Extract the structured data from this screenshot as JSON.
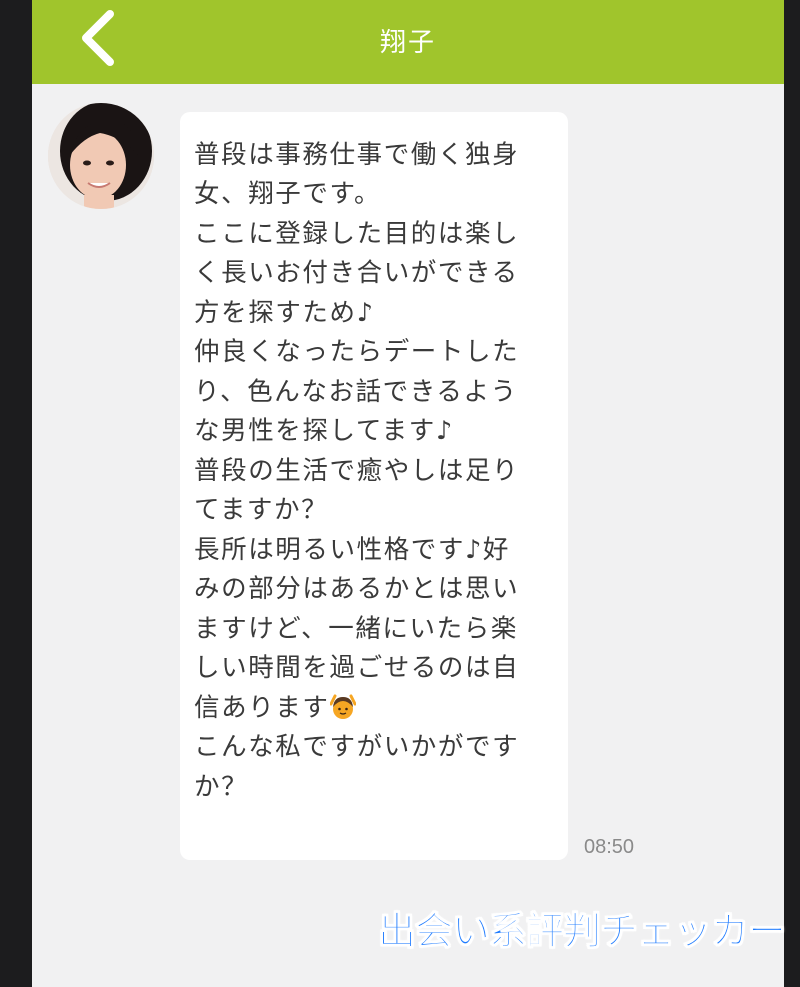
{
  "header": {
    "title": "翔子",
    "back_icon": "chevron-left-icon",
    "background_color": "#a0c52c"
  },
  "message": {
    "lines": [
      "普段は事務仕事で働く独身",
      "女、翔子です。",
      "ここに登録した目的は楽し",
      "く長いお付き合いができる",
      "方を探すため♪",
      "仲良くなったらデートした",
      "り、色んなお話できるよう",
      "な男性を探してます♪",
      "普段の生活で癒やしは足り",
      "てますか？",
      "長所は明るい性格です♪好",
      "みの部分はあるかとは思い",
      "ますけど、一緒にいたら楽",
      "しい時間を過ごせるのは自",
      "信あります",
      "こんな私ですがいかがです",
      "か？"
    ],
    "trailing_emoji": "ok-gesture-woman-icon",
    "time": "08:50"
  },
  "watermark": {
    "text": "出会い系評判チェッカー",
    "color": "#1e7bff"
  }
}
